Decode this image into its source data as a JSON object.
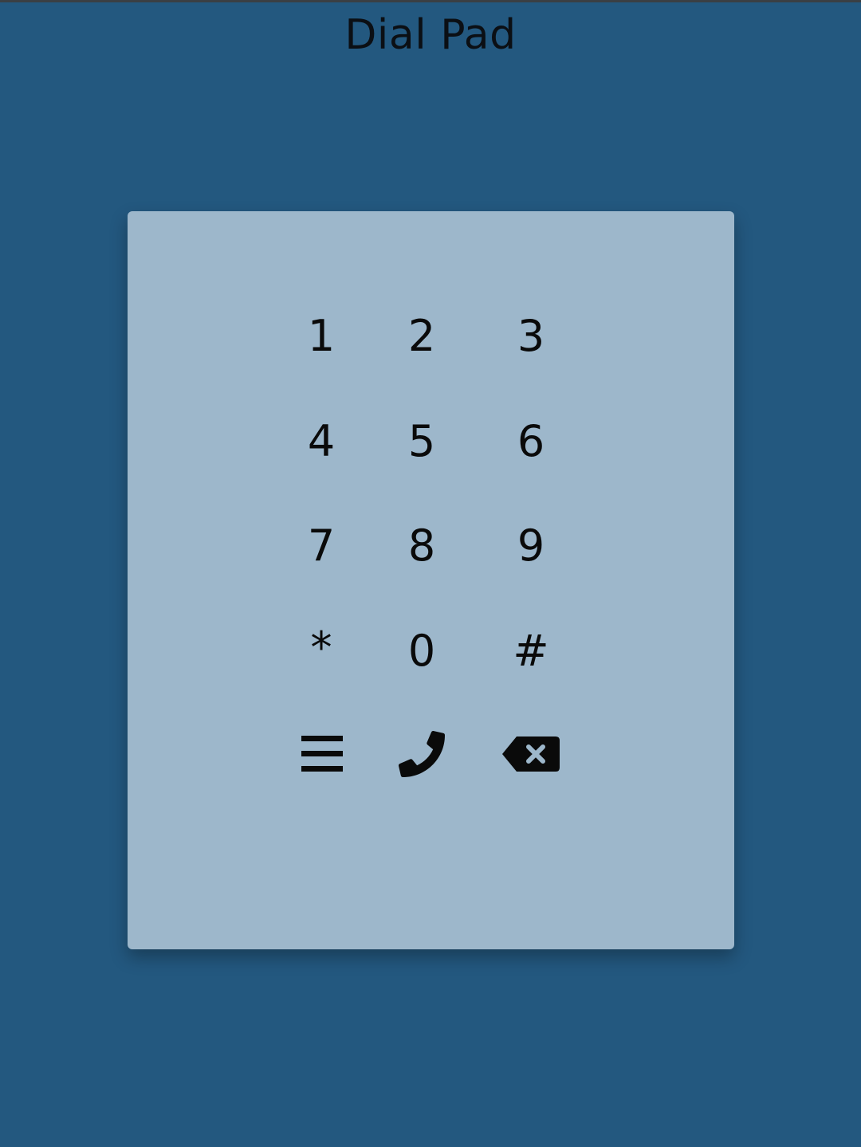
{
  "header": {
    "title": "Dial Pad"
  },
  "keypad": {
    "keys": [
      "1",
      "2",
      "3",
      "4",
      "5",
      "6",
      "7",
      "8",
      "9",
      "*",
      "0",
      "#"
    ]
  },
  "actions": {
    "menu_icon": "hamburger-menu-icon",
    "call_icon": "phone-icon",
    "backspace_icon": "backspace-icon"
  },
  "colors": {
    "background": "#23587f",
    "card": "#9db7cb",
    "text": "#0a0a0a"
  }
}
